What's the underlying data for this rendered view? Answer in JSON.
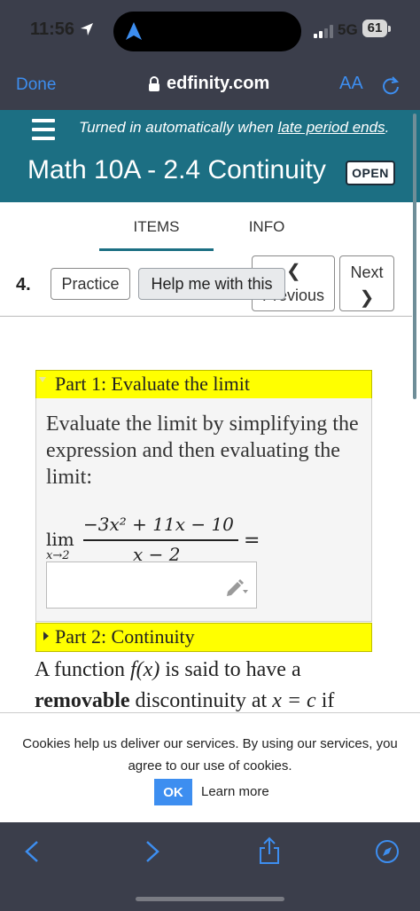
{
  "status_bar": {
    "time": "11:56",
    "network": "5G",
    "battery": "61",
    "icons": [
      "location-arrow-icon",
      "navigation-icon",
      "signal-icon",
      "battery-icon"
    ]
  },
  "browser": {
    "done_label": "Done",
    "url": "edfinity.com",
    "text_size_label": "AA",
    "accent_color": "#3d8ef0",
    "icons": [
      "lock-icon",
      "reload-icon"
    ]
  },
  "header": {
    "notice_prefix": "Turned in automatically when ",
    "notice_link": "late period ends",
    "notice_suffix": ".",
    "title": "Math 10A - 2.4 Continuity",
    "badge": "OPEN",
    "bg_color": "#1c6f83"
  },
  "tabs": [
    {
      "label": "ITEMS",
      "active": true
    },
    {
      "label": "INFO",
      "active": false
    }
  ],
  "question": {
    "number": "4.",
    "practice_label": "Practice",
    "help_label": "Help me with this",
    "previous_label": "Previous",
    "next_label": "Next"
  },
  "part1": {
    "title": "Part 1: Evaluate the limit",
    "instructions": "Evaluate the limit by simplifying the expression and then evaluating the limit:",
    "limit_word": "lim",
    "limit_sub": "x→2",
    "numerator": "−3x² + 11x − 10",
    "denominator": "x − 2",
    "equals": "=",
    "answer_value": "",
    "header_color": "#ffff00"
  },
  "part2": {
    "title": "Part 2: Continuity",
    "text_a": "A function ",
    "fx": "f(x)",
    "text_b": " is said to have a ",
    "bold": "removable",
    "text_c": " discontinuity at ",
    "cond": "x = c",
    "text_d": " if"
  },
  "cookie": {
    "message": "Cookies help us deliver our services. By using our services, you agree to our use of cookies.",
    "ok_label": "OK",
    "learn_more": "Learn more"
  },
  "toolbar": {
    "icons": [
      "back-icon",
      "forward-icon",
      "share-icon",
      "compass-icon"
    ]
  }
}
